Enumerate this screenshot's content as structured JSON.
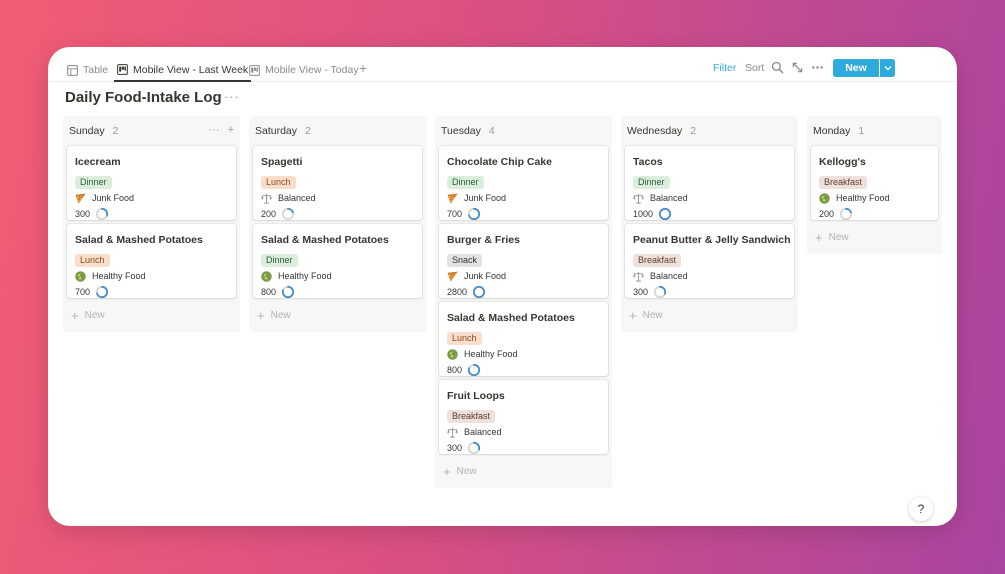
{
  "tabs": [
    {
      "label": "Table",
      "icon": "table-icon",
      "active": false
    },
    {
      "label": "Mobile View - Last Week",
      "icon": "board-icon",
      "active": true
    },
    {
      "label": "Mobile View - Today",
      "icon": "board-icon",
      "active": false
    }
  ],
  "toolbar": {
    "filter_label": "Filter",
    "sort_label": "Sort",
    "new_label": "New"
  },
  "page": {
    "title": "Daily Food-Intake Log"
  },
  "new_card_label": "New",
  "help_label": "?",
  "colors": {
    "accent": "#2eaadc",
    "progress": "#4a90c8"
  },
  "columns": [
    {
      "name": "Sunday",
      "count": "2",
      "cards": [
        {
          "title": "Icecream",
          "meal": "Dinner",
          "category": "Junk Food",
          "category_icon": "pizza-icon",
          "calories": "300",
          "progress": 0.3
        },
        {
          "title": "Salad & Mashed Potatoes",
          "meal": "Lunch",
          "category": "Healthy Food",
          "category_icon": "salad-icon",
          "calories": "700",
          "progress": 0.7
        }
      ]
    },
    {
      "name": "Saturday",
      "count": "2",
      "cards": [
        {
          "title": "Spagetti",
          "meal": "Lunch",
          "category": "Balanced",
          "category_icon": "scale-icon",
          "calories": "200",
          "progress": 0.2
        },
        {
          "title": "Salad & Mashed Potatoes",
          "meal": "Dinner",
          "category": "Healthy Food",
          "category_icon": "salad-icon",
          "calories": "800",
          "progress": 0.8
        }
      ]
    },
    {
      "name": "Tuesday",
      "count": "4",
      "cards": [
        {
          "title": "Chocolate Chip Cake",
          "meal": "Dinner",
          "category": "Junk Food",
          "category_icon": "pizza-icon",
          "calories": "700",
          "progress": 0.7
        },
        {
          "title": "Burger & Fries",
          "meal": "Snack",
          "category": "Junk Food",
          "category_icon": "pizza-icon",
          "calories": "2800",
          "progress": 1.0
        },
        {
          "title": "Salad & Mashed Potatoes",
          "meal": "Lunch",
          "category": "Healthy Food",
          "category_icon": "salad-icon",
          "calories": "800",
          "progress": 0.8
        },
        {
          "title": "Fruit Loops",
          "meal": "Breakfast",
          "category": "Balanced",
          "category_icon": "scale-icon",
          "calories": "300",
          "progress": 0.3
        }
      ]
    },
    {
      "name": "Wednesday",
      "count": "2",
      "cards": [
        {
          "title": "Tacos",
          "meal": "Dinner",
          "category": "Balanced",
          "category_icon": "scale-icon",
          "calories": "1000",
          "progress": 1.0
        },
        {
          "title": "Peanut Butter & Jelly Sandwich",
          "meal": "Breakfast",
          "category": "Balanced",
          "category_icon": "scale-icon",
          "calories": "300",
          "progress": 0.3
        }
      ]
    },
    {
      "name": "Monday",
      "count": "1",
      "cards": [
        {
          "title": "Kellogg's",
          "meal": "Breakfast",
          "category": "Healthy Food",
          "category_icon": "salad-icon",
          "calories": "200",
          "progress": 0.2
        }
      ]
    }
  ]
}
